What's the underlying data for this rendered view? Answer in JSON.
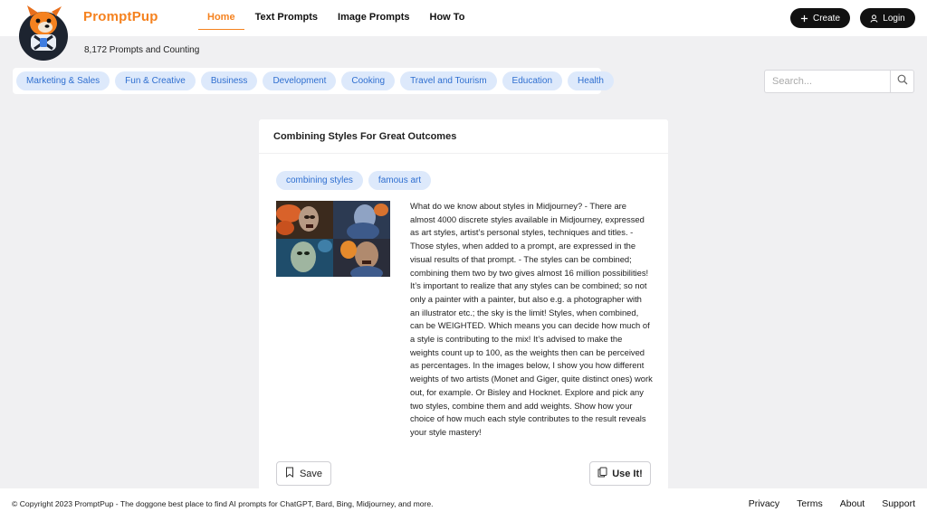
{
  "brand": {
    "name": "PromptPup",
    "tagline": "8,172 Prompts and Counting",
    "accent_color": "#f5821f"
  },
  "nav": {
    "items": [
      {
        "label": "Home",
        "active": true
      },
      {
        "label": "Text Prompts",
        "active": false
      },
      {
        "label": "Image Prompts",
        "active": false
      },
      {
        "label": "How To",
        "active": false
      }
    ]
  },
  "header_actions": {
    "create_label": "Create",
    "create_icon": "plus-icon",
    "login_label": "Login",
    "login_icon": "user-icon"
  },
  "categories": [
    "Marketing & Sales",
    "Fun & Creative",
    "Business",
    "Development",
    "Cooking",
    "Travel and Tourism",
    "Education",
    "Health"
  ],
  "search": {
    "placeholder": "Search...",
    "value": "",
    "icon": "search-icon"
  },
  "prompt": {
    "title": "Combining Styles For Great Outcomes",
    "tags": [
      "combining styles",
      "famous art"
    ],
    "description": "What do we know about styles in Midjourney? - There are almost 4000 discrete styles available in Midjourney, expressed as art styles, artist’s personal styles, techniques and titles. - Those styles, when added to a prompt, are expressed in the visual results of that prompt. - The styles can be combined; combining them two by two gives almost 16 million possibilities! It’s important to realize that any styles can be combined; so not only a painter with a painter, but also e.g. a photographer with an illustrator etc.; the sky is the limit! Styles, when combined, can be WEIGHTED. Which means you can decide how much of a style is contributing to the mix! It’s advised to make the weights count up to 100, as the weights then can be perceived as percentages. In the images below, I show you how different weights of two artists (Monet and Giger, quite distinct ones) work out, for example. Or Bisley and Hocknet. Explore and pick any two styles, combine them and add weights. Show how your choice of how much each style contributes to the result reveals your style mastery!",
    "save_label": "Save",
    "save_icon": "bookmark-icon",
    "use_label": "Use It!",
    "use_icon": "copy-icon"
  },
  "footer": {
    "copyright": "© Copyright 2023 PromptPup - The doggone best place to find AI prompts for ChatGPT, Bard, Bing, Midjourney, and more.",
    "links": [
      "Privacy",
      "Terms",
      "About",
      "Support"
    ]
  }
}
